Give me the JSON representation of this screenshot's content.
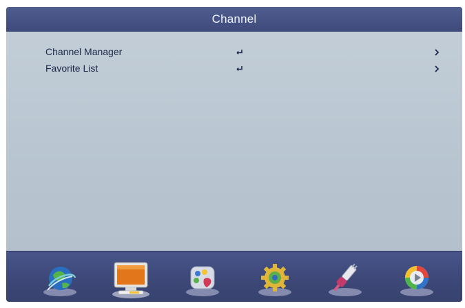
{
  "header": {
    "title": "Channel"
  },
  "menu": {
    "items": [
      {
        "label": "Channel Manager",
        "enter_icon": "enter-icon",
        "arrow_icon": "chevron-right-icon"
      },
      {
        "label": "Favorite List",
        "enter_icon": "enter-icon",
        "arrow_icon": "chevron-right-icon"
      }
    ]
  },
  "dock": {
    "items": [
      {
        "icon": "globe-signal-icon",
        "selected": false
      },
      {
        "icon": "tv-channel-icon",
        "selected": true
      },
      {
        "icon": "picture-palette-icon",
        "selected": false
      },
      {
        "icon": "settings-gear-icon",
        "selected": false
      },
      {
        "icon": "usb-plug-icon",
        "selected": false
      },
      {
        "icon": "media-play-icon",
        "selected": false
      }
    ]
  },
  "colors": {
    "title_bar": "#45528a",
    "content_background": "#bac7d2",
    "dock_background": "#3f4a7b",
    "text": "#1d2a4a"
  }
}
